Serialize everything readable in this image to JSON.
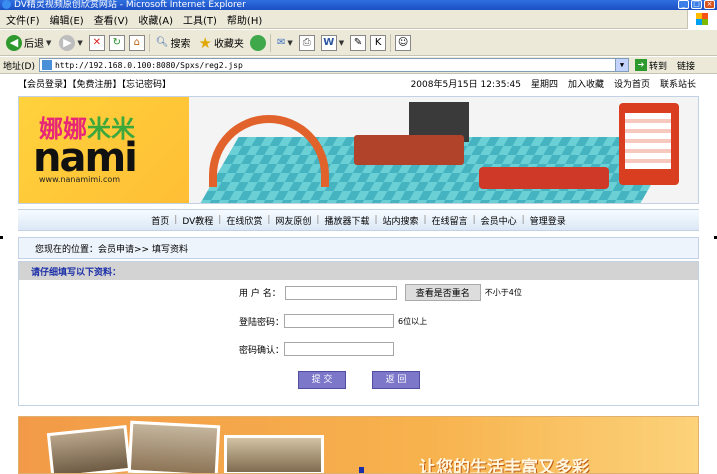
{
  "window": {
    "title": "DV精灵视频原创欣赏网站 - Microsoft Internet Explorer",
    "controls": [
      "_",
      "□",
      "×"
    ]
  },
  "menu": [
    "文件(F)",
    "编辑(E)",
    "查看(V)",
    "收藏(A)",
    "工具(T)",
    "帮助(H)"
  ],
  "toolbar": {
    "back_label": "后退",
    "search_label": "搜索",
    "favorites_label": "收藏夹"
  },
  "addressbar": {
    "label": "地址(D)",
    "url": "http://192.168.0.100:8080/Spxs/reg2.jsp",
    "go_label": "转到",
    "links_label": "链接"
  },
  "topstrip": {
    "links": "【会员登录】【免费注册】【忘记密码】",
    "datetime": "2008年5月15日 12:35:45",
    "weekday": "星期四",
    "add_favorite": "加入收藏",
    "set_home": "设为首页",
    "contact": "联系站长"
  },
  "banner": {
    "logo_cn_pink": "娜娜",
    "logo_cn_green": "米米",
    "logo_en": "nami",
    "logo_url": "www.nanamimi.com"
  },
  "nav": [
    "首页",
    "DV教程",
    "在线欣赏",
    "网友原创",
    "播放器下载",
    "站内搜索",
    "在线留言",
    "会员中心",
    "管理登录"
  ],
  "breadcrumb": "您现在的位置：会员申请>> 填写资料",
  "form": {
    "heading": "请仔细填写以下资料：",
    "username_label": "用 户 名：",
    "username_value": "",
    "check_button": "查看是否重名",
    "username_hint": "不小于4位",
    "password_label": "登陆密码：",
    "password_hint": "6位以上",
    "confirm_label": "密码确认：",
    "submit": "提 交",
    "back": "返 回"
  },
  "bottom_banner": {
    "slogan": "让您的生活丰富又多彩"
  }
}
